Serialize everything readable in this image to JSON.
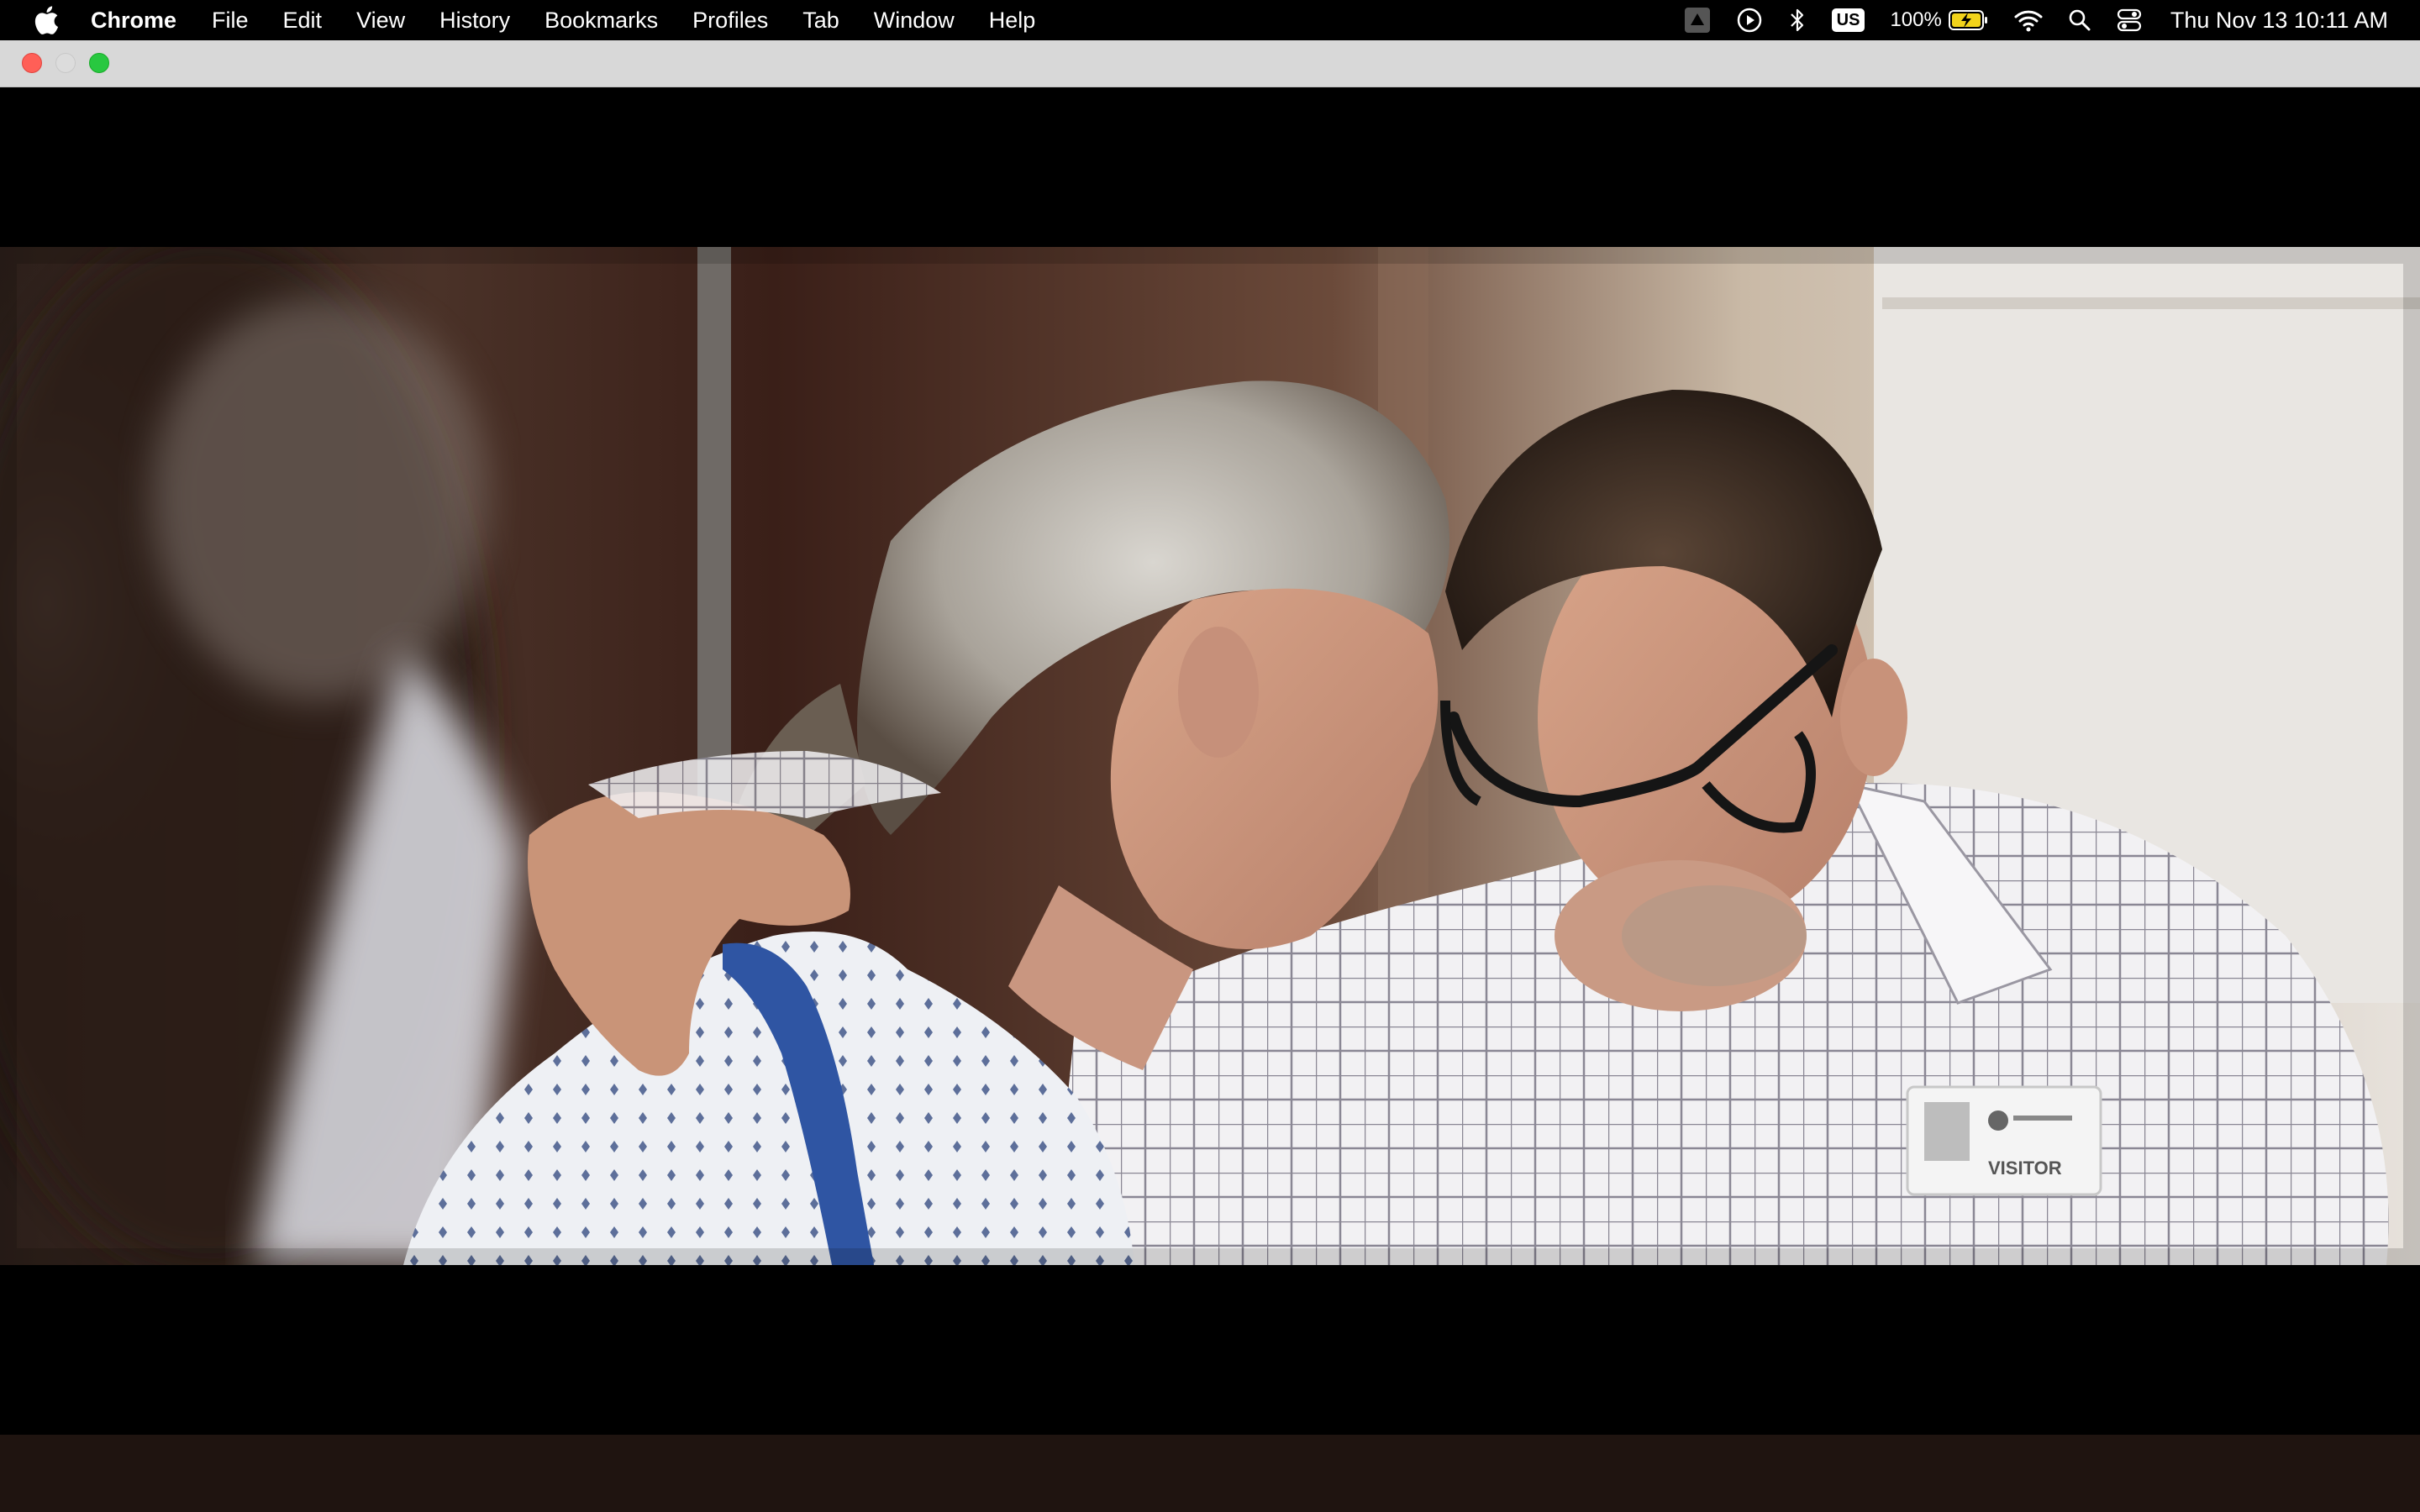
{
  "menubar": {
    "app_name": "Chrome",
    "menus": [
      "File",
      "Edit",
      "View",
      "History",
      "Bookmarks",
      "Profiles",
      "Tab",
      "Window",
      "Help"
    ],
    "input_source": "US",
    "battery_percent": "100%",
    "clock": "Thu Nov 13  10:11 AM"
  },
  "video": {
    "badge_text": "VISITOR"
  },
  "colors": {
    "menubar_bg": "#000000",
    "titlebar_bg": "#d8d8d8",
    "close": "#ff5f57",
    "minimize": "#dcdcdc",
    "maximize": "#28c840",
    "bottom_strip": "#1f1410"
  }
}
